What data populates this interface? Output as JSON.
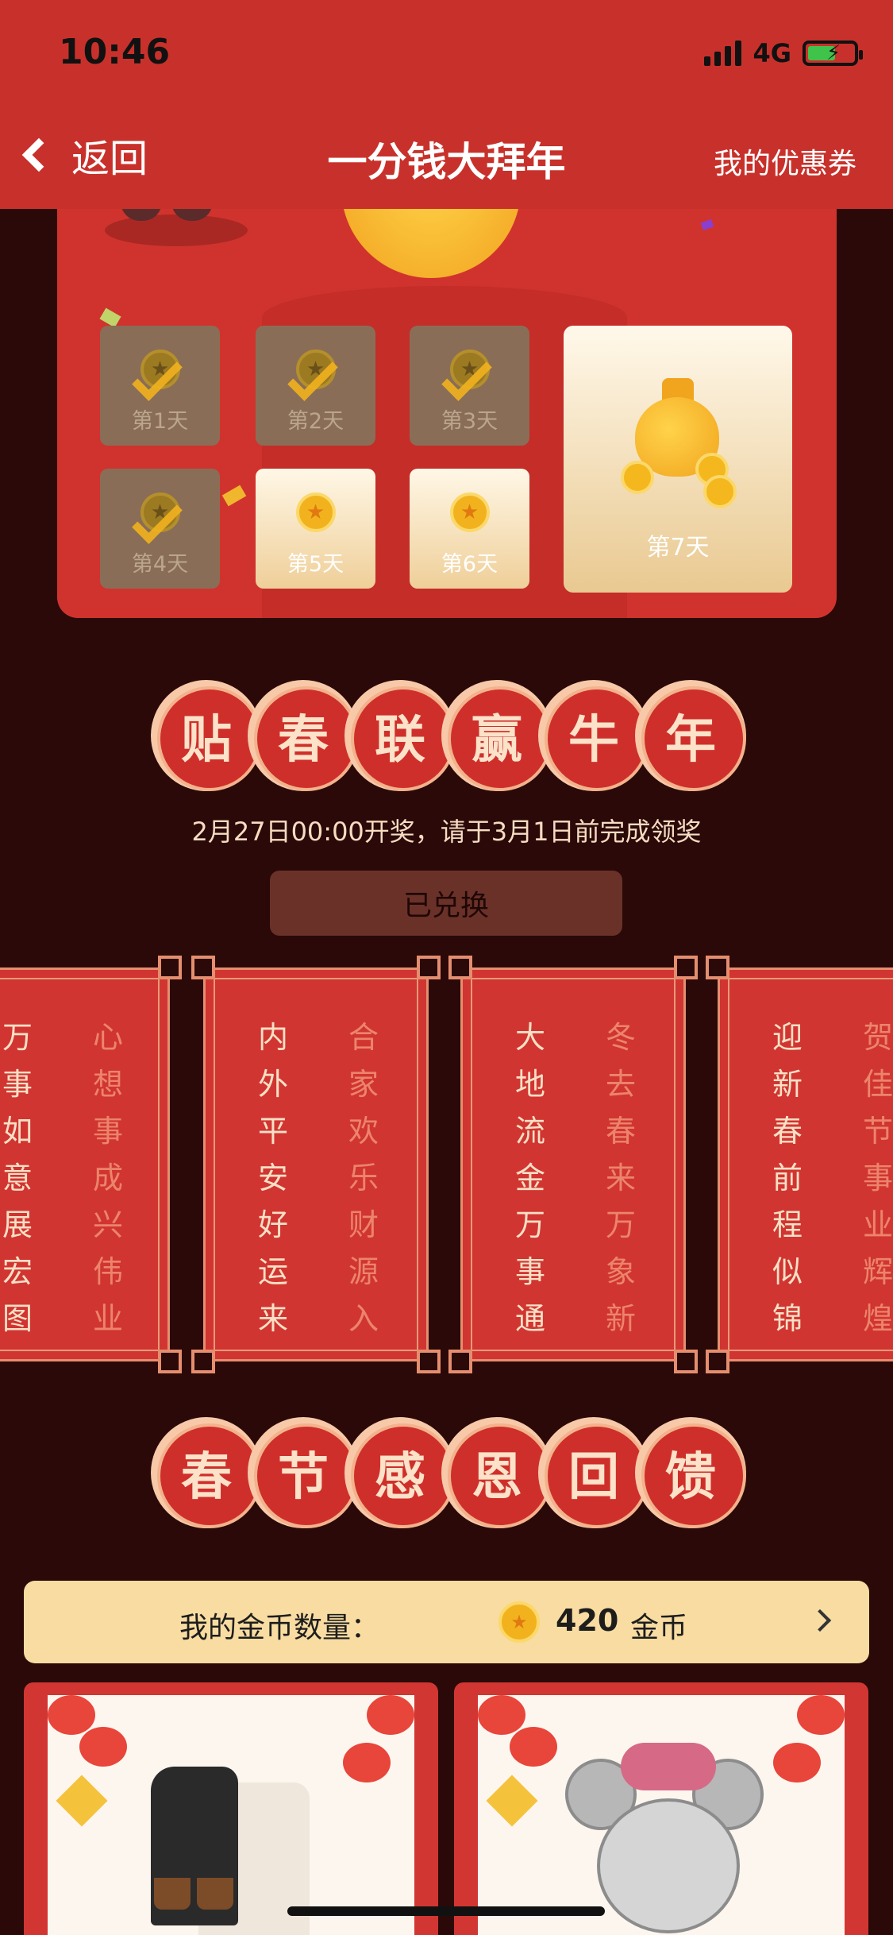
{
  "status": {
    "time": "10:46",
    "network": "4G"
  },
  "nav": {
    "back_label": "返回",
    "title": "一分钱大拜年",
    "coupon_label": "我的优惠券"
  },
  "signin": {
    "days": [
      {
        "label": "第1天",
        "state": "done"
      },
      {
        "label": "第2天",
        "state": "done"
      },
      {
        "label": "第3天",
        "state": "done"
      },
      {
        "label": "第4天",
        "state": "done"
      },
      {
        "label": "第5天",
        "state": "open"
      },
      {
        "label": "第6天",
        "state": "open"
      },
      {
        "label": "第7天",
        "state": "grand"
      }
    ]
  },
  "section1": {
    "chars": [
      "贴",
      "春",
      "联",
      "赢",
      "牛",
      "年"
    ]
  },
  "notice": "2月27日00:00开奖，请于3月1日前完成领奖",
  "redeem_button": "已兑换",
  "couplets": [
    {
      "left": [
        "万",
        "事",
        "如",
        "意",
        "展",
        "宏",
        "图"
      ],
      "right": [
        "心",
        "想",
        "事",
        "成",
        "兴",
        "伟",
        "业"
      ]
    },
    {
      "left": [
        "内",
        "外",
        "平",
        "安",
        "好",
        "运",
        "来"
      ],
      "right": [
        "合",
        "家",
        "欢",
        "乐",
        "财",
        "源",
        "入"
      ]
    },
    {
      "left": [
        "大",
        "地",
        "流",
        "金",
        "万",
        "事",
        "通"
      ],
      "right": [
        "冬",
        "去",
        "春",
        "来",
        "万",
        "象",
        "新"
      ]
    },
    {
      "left": [
        "迎",
        "新",
        "春",
        "前",
        "程",
        "似",
        "锦"
      ],
      "right": [
        "贺",
        "佳",
        "节",
        "事",
        "业",
        "辉",
        "煌"
      ]
    }
  ],
  "section2": {
    "chars": [
      "春",
      "节",
      "感",
      "恩",
      "回",
      "馈"
    ]
  },
  "gold": {
    "label": "我的金币数量：",
    "count": "420",
    "unit": "金币"
  },
  "colors": {
    "primary_red": "#c8312b",
    "background": "#2a0908",
    "gold_bar": "#f8dca1"
  }
}
